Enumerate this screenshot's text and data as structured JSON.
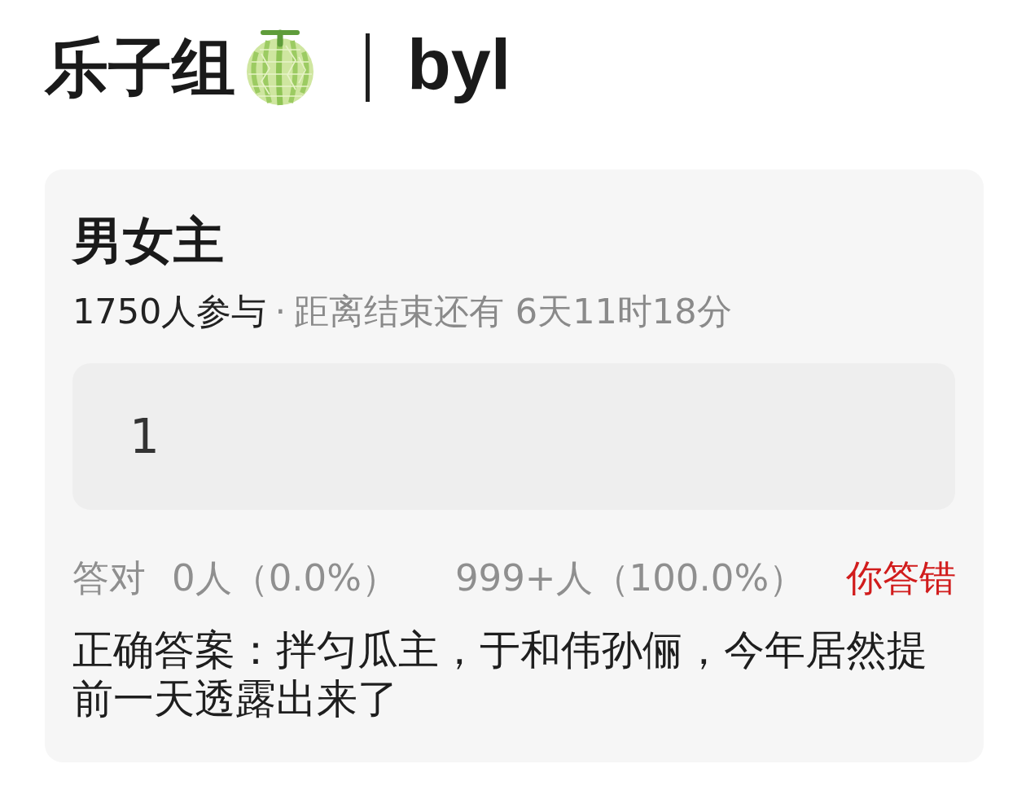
{
  "header": {
    "group": "乐子组",
    "author": "byl"
  },
  "quiz": {
    "title": "男女主",
    "participants": "1750人参与",
    "separator": "·",
    "deadline": "距离结束还有 6天11时18分",
    "answer": {
      "value": "1"
    },
    "stats": {
      "correct_label": "答对",
      "correct": "0人（0.0%）",
      "wrong": "999+人（100.0%）",
      "result": "你答错"
    },
    "correct_answer": "正确答案：拌匀瓜主，于和伟孙俪，今年居然提前一天透露出来了"
  }
}
